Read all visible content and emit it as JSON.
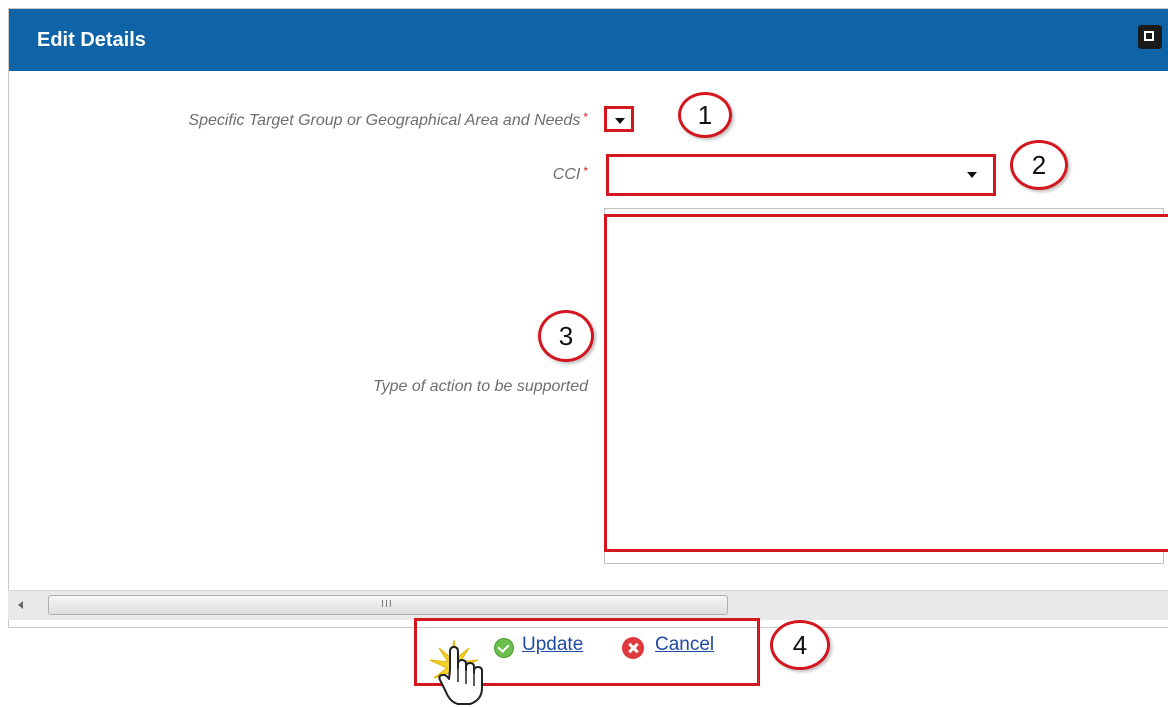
{
  "dialog": {
    "title": "Edit Details"
  },
  "form": {
    "target_group": {
      "label": "Specific Target Group or Geographical Area and Needs",
      "required_mark": "*",
      "value": ""
    },
    "cci": {
      "label": "CCI",
      "required_mark": "*",
      "value": ""
    },
    "type_of_action": {
      "label": "Type of action to be supported",
      "value": ""
    }
  },
  "actions": {
    "update_label": "Update",
    "cancel_label": "Cancel"
  },
  "callouts": [
    "1",
    "2",
    "3",
    "4"
  ],
  "scrollbar": {
    "grip": "III"
  },
  "icons": {
    "maximize": "maximize-icon",
    "update": "check-circle-icon",
    "cancel": "x-circle-icon",
    "cursor": "hand-pointer-icon"
  },
  "colors": {
    "titlebar": "#0f64a8",
    "highlight": "#d4161f",
    "link": "#1f4aa3",
    "ok_icon": "#6cbf4a",
    "cancel_icon": "#e0383e"
  }
}
